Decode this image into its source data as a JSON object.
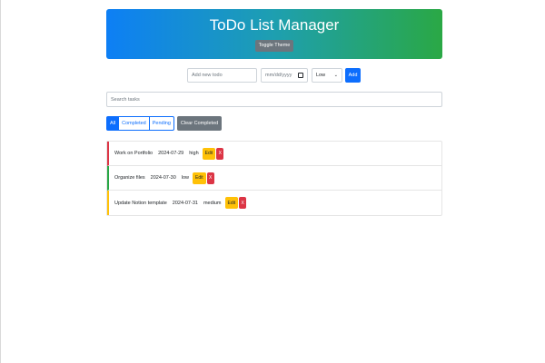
{
  "header": {
    "title": "ToDo List Manager",
    "toggle_label": "Toggle Theme"
  },
  "add_form": {
    "todo_placeholder": "Add new todo",
    "date_placeholder": "mm/dd/yyyy",
    "priority_value": "Low",
    "add_label": "Add"
  },
  "search": {
    "placeholder": "Search tasks"
  },
  "filters": {
    "tabs": [
      {
        "label": "All",
        "active": true
      },
      {
        "label": "Completed",
        "active": false
      },
      {
        "label": "Pending",
        "active": false
      }
    ],
    "clear_label": "Clear Completed"
  },
  "todos": [
    {
      "title": "Work on Portfolio",
      "date": "2024-07-29",
      "priority": "high",
      "edit": "Edit",
      "delete": "X"
    },
    {
      "title": "Organize files",
      "date": "2024-07-30",
      "priority": "low",
      "edit": "Edit",
      "delete": "X"
    },
    {
      "title": "Update Notion template",
      "date": "2024-07-31",
      "priority": "medium",
      "edit": "Edit",
      "delete": "X"
    }
  ],
  "colors": {
    "primary": "#0d6efd",
    "secondary": "#6c757d",
    "warning": "#ffc107",
    "danger": "#dc3545",
    "success": "#28a745",
    "gradient_start": "#0d7ff5",
    "gradient_end": "#2aa845"
  }
}
